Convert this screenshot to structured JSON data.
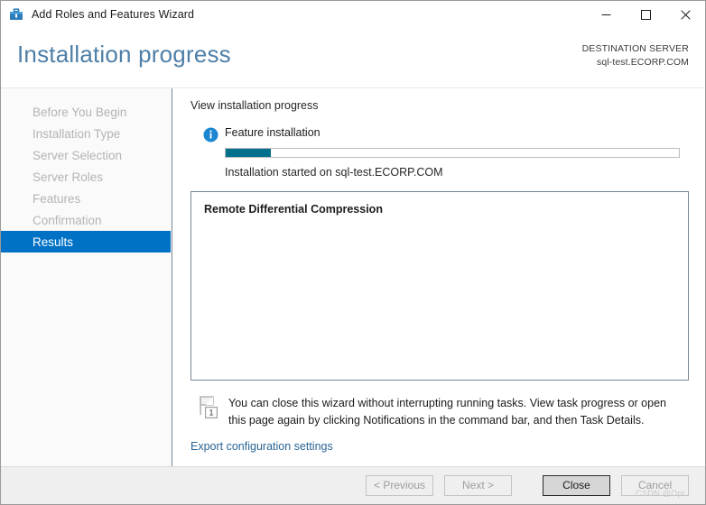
{
  "window": {
    "title": "Add Roles and Features Wizard",
    "icon": "server-manager-toolbox-icon",
    "minimize_label": "—",
    "maximize_label": "☐",
    "close_label": "✕"
  },
  "header": {
    "page_title": "Installation progress",
    "destination_label": "DESTINATION SERVER",
    "destination_value": "sql-test.ECORP.COM"
  },
  "sidebar": {
    "items": [
      {
        "label": "Before You Begin",
        "active": false
      },
      {
        "label": "Installation Type",
        "active": false
      },
      {
        "label": "Server Selection",
        "active": false
      },
      {
        "label": "Server Roles",
        "active": false
      },
      {
        "label": "Features",
        "active": false
      },
      {
        "label": "Confirmation",
        "active": false
      },
      {
        "label": "Results",
        "active": true
      }
    ]
  },
  "content": {
    "section_heading": "View installation progress",
    "feature_status_label": "Feature installation",
    "progress_percent": 10,
    "progress_caption": "Installation started on sql-test.ECORP.COM",
    "results": [
      "Remote Differential Compression"
    ],
    "notice_text": "You can close this wizard without interrupting running tasks. View task progress or open this page again by clicking Notifications in the command bar, and then Task Details.",
    "notice_badge_count": "1",
    "export_link_label": "Export configuration settings"
  },
  "footer": {
    "buttons": [
      {
        "label": "< Previous",
        "state": "disabled"
      },
      {
        "label": "Next >",
        "state": "disabled"
      },
      {
        "label": "Close",
        "state": "default"
      },
      {
        "label": "Cancel",
        "state": "disabled"
      }
    ],
    "watermark": "CSDN @Opr"
  },
  "colors": {
    "accent": "#0072c6",
    "title_blue": "#4e7fa8",
    "progress_fill": "#00708c",
    "link": "#2a6496"
  }
}
